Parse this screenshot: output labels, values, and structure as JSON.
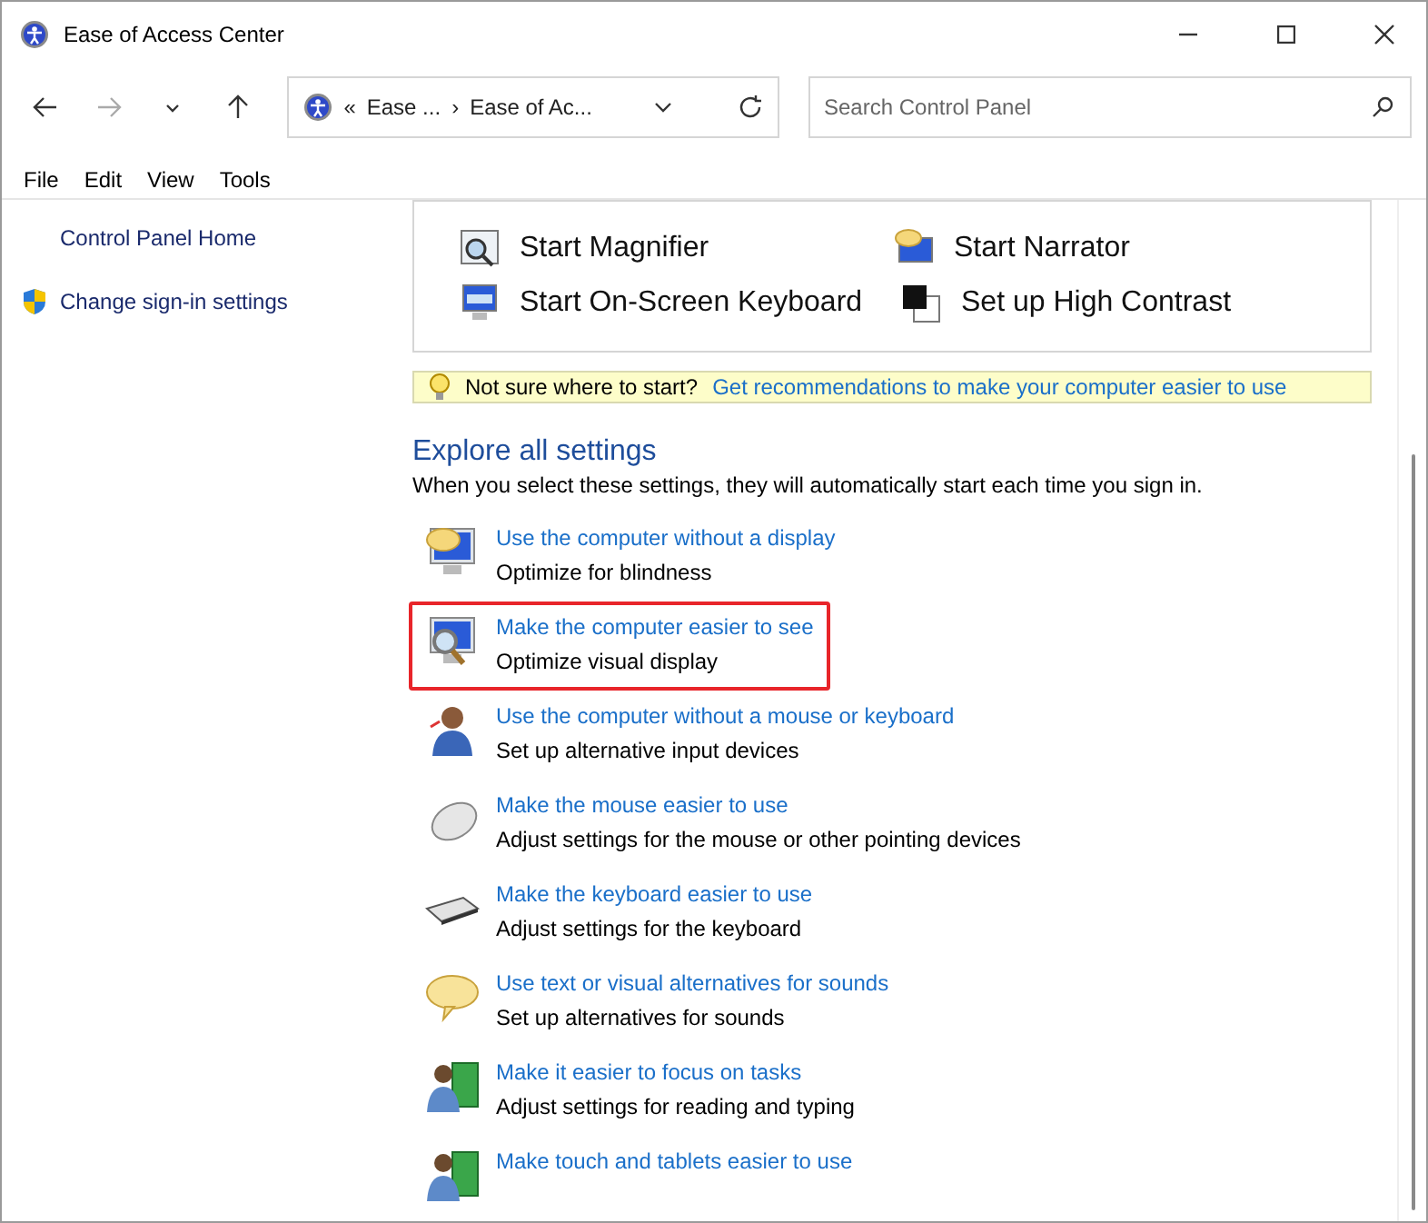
{
  "window": {
    "title": "Ease of Access Center"
  },
  "address_bar": {
    "crumbs": [
      "«",
      "Ease ...",
      "›",
      "Ease of Ac..."
    ]
  },
  "search": {
    "placeholder": "Search Control Panel"
  },
  "menu": [
    "File",
    "Edit",
    "View",
    "Tools"
  ],
  "sidebar": {
    "items": [
      {
        "label": "Control Panel Home",
        "shield": false
      },
      {
        "label": "Change sign-in settings",
        "shield": true
      }
    ]
  },
  "quick_access": [
    {
      "label": "Start Magnifier"
    },
    {
      "label": "Start Narrator"
    },
    {
      "label": "Start On-Screen Keyboard"
    },
    {
      "label": "Set up High Contrast"
    }
  ],
  "tip": {
    "text": "Not sure where to start?",
    "link": "Get recommendations to make your computer easier to use"
  },
  "explore": {
    "heading": "Explore all settings",
    "intro": "When you select these settings, they will automatically start each time you sign in.",
    "items": [
      {
        "link": "Use the computer without a display",
        "description": "Optimize for blindness",
        "highlighted": false
      },
      {
        "link": "Make the computer easier to see",
        "description": "Optimize visual display",
        "highlighted": true
      },
      {
        "link": "Use the computer without a mouse or keyboard",
        "description": "Set up alternative input devices",
        "highlighted": false
      },
      {
        "link": "Make the mouse easier to use",
        "description": "Adjust settings for the mouse or other pointing devices",
        "highlighted": false
      },
      {
        "link": "Make the keyboard easier to use",
        "description": "Adjust settings for the keyboard",
        "highlighted": false
      },
      {
        "link": "Use text or visual alternatives for sounds",
        "description": "Set up alternatives for sounds",
        "highlighted": false
      },
      {
        "link": "Make it easier to focus on tasks",
        "description": "Adjust settings for reading and typing",
        "highlighted": false
      },
      {
        "link": "Make touch and tablets easier to use",
        "highlighted": false
      }
    ]
  }
}
